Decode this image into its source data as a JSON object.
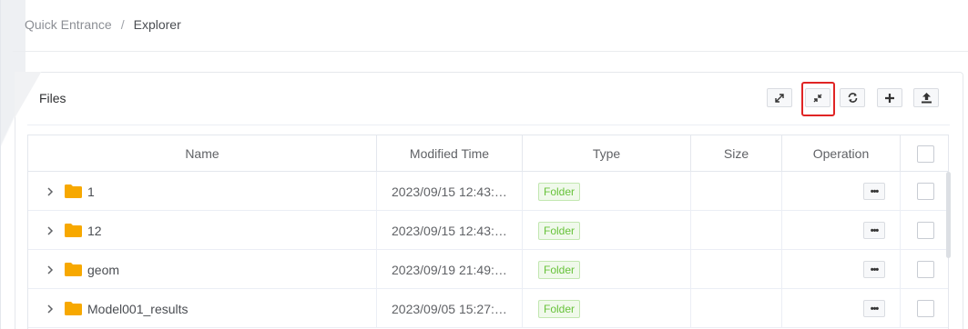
{
  "breadcrumb": {
    "home": "Quick Entrance",
    "separator": "/",
    "current": "Explorer"
  },
  "card": {
    "title": "Files"
  },
  "toolbar": {
    "buttons": [
      {
        "name": "expand-icon"
      },
      {
        "name": "collapse-icon"
      },
      {
        "name": "refresh-icon"
      },
      {
        "name": "plus-icon"
      },
      {
        "name": "upload-icon"
      }
    ],
    "highlighted": "collapse-icon",
    "highlight_color": "#e02424"
  },
  "table": {
    "columns": [
      "Name",
      "Modified Time",
      "Type",
      "Size",
      "Operation"
    ],
    "rows": [
      {
        "name": "1",
        "modified": "2023/09/15 12:43:…",
        "type": "Folder",
        "size": "",
        "operation": "•••"
      },
      {
        "name": "12",
        "modified": "2023/09/15 12:43:…",
        "type": "Folder",
        "size": "",
        "operation": "•••"
      },
      {
        "name": "geom",
        "modified": "2023/09/19 21:49:…",
        "type": "Folder",
        "size": "",
        "operation": "•••"
      },
      {
        "name": "Model001_results",
        "modified": "2023/09/05 15:27:…",
        "type": "Folder",
        "size": "",
        "operation": "•••"
      }
    ]
  },
  "colors": {
    "folder": "#f7a800",
    "tag_green": "#67c23a"
  }
}
